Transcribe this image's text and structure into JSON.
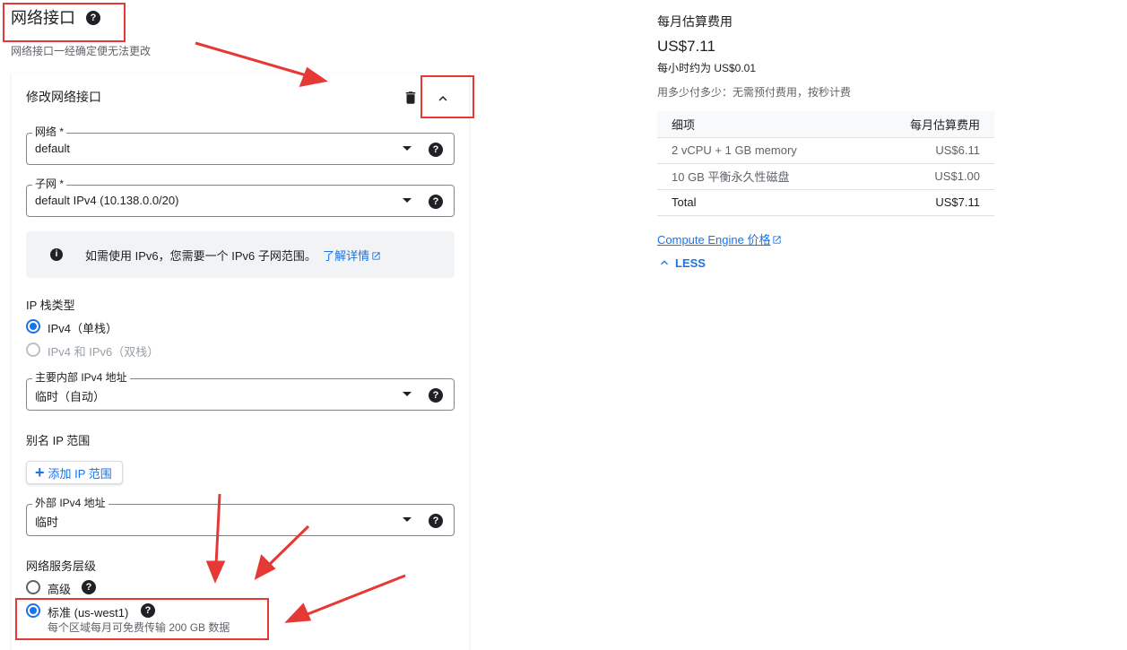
{
  "header": {
    "title": "网络接口",
    "subtitle": "网络接口一经确定便无法更改",
    "help_icon": "help-circle-icon"
  },
  "card": {
    "title": "修改网络接口",
    "delete_icon": "trash-icon",
    "collapse_icon": "chevron-up-icon",
    "network": {
      "label": "网络 *",
      "value": "default"
    },
    "subnet": {
      "label": "子网 *",
      "value": "default IPv4 (10.138.0.0/20)"
    },
    "info": {
      "text": "如需使用 IPv6，您需要一个 IPv6 子网范围。",
      "link": "了解详情",
      "link_icon": "external-link-icon"
    },
    "ip_stack": {
      "label": "IP 栈类型",
      "options": [
        {
          "label": "IPv4（单栈）",
          "selected": true,
          "disabled": false
        },
        {
          "label": "IPv4 和 IPv6（双栈）",
          "selected": false,
          "disabled": true
        }
      ]
    },
    "primary_ip": {
      "label": "主要内部 IPv4 地址",
      "value": "临时（自动）"
    },
    "alias": {
      "label": "别名 IP 范围",
      "add_button": "添加 IP 范围"
    },
    "external_ip": {
      "label": "外部 IPv4 地址",
      "value": "临时"
    },
    "tier": {
      "label": "网络服务层级",
      "premium": {
        "label": "高级",
        "selected": false
      },
      "standard": {
        "label": "标准 (us-west1)",
        "selected": true,
        "note": "每个区域每月可免费传输 200 GB 数据"
      }
    }
  },
  "estimate": {
    "title": "每月估算费用",
    "price": "US$7.11",
    "hourly": "每小时约为 US$0.01",
    "note": "用多少付多少：无需预付费用，按秒计费",
    "table": {
      "headers": [
        "细项",
        "每月估算费用"
      ],
      "rows": [
        [
          "2 vCPU + 1 GB memory",
          "US$6.11"
        ],
        [
          "10 GB 平衡永久性磁盘",
          "US$1.00"
        ],
        [
          "Total",
          "US$7.11"
        ]
      ]
    },
    "pricing_link": "Compute Engine 价格",
    "less_button": "LESS"
  },
  "colors": {
    "accent": "#1a73e8",
    "annotation_red": "#e53935"
  }
}
